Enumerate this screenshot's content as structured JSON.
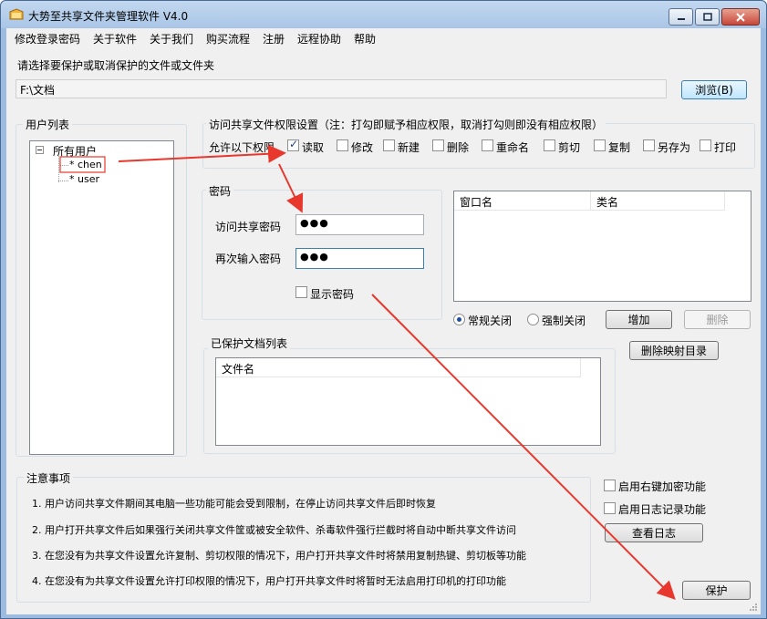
{
  "window": {
    "title": "大势至共享文件夹管理软件 V4.0",
    "controls": {
      "minimize": "minimize",
      "maximize": "maximize",
      "close": "close"
    }
  },
  "menu": [
    "修改登录密码",
    "关于软件",
    "关于我们",
    "购买流程",
    "注册",
    "远程协助",
    "帮助"
  ],
  "path_section": {
    "prompt": "请选择要保护或取消保护的文件或文件夹",
    "path_value": "F:\\文档",
    "browse_label": "浏览(B)"
  },
  "users": {
    "group_title": "用户列表",
    "root": "所有用户",
    "items": [
      "* chen",
      "* user"
    ],
    "selected_index": 0
  },
  "permissions": {
    "group_title": "访问共享文件权限设置（注：打勾即赋予相应权限，取消打勾则即没有相应权限）",
    "allow_label": "允许以下权限",
    "items": [
      {
        "label": "读取",
        "checked": true
      },
      {
        "label": "修改",
        "checked": false
      },
      {
        "label": "新建",
        "checked": false
      },
      {
        "label": "删除",
        "checked": false
      },
      {
        "label": "重命名",
        "checked": false
      },
      {
        "label": "剪切",
        "checked": false
      },
      {
        "label": "复制",
        "checked": false
      },
      {
        "label": "另存为",
        "checked": false
      },
      {
        "label": "打印",
        "checked": false
      }
    ]
  },
  "password": {
    "group_title": "密码",
    "access_label": "访问共享密码",
    "access_value": "●●●",
    "confirm_label": "再次输入密码",
    "confirm_value": "●●●",
    "show_label": "显示密码",
    "show_checked": false
  },
  "window_list": {
    "columns": [
      "窗口名",
      "类名"
    ],
    "close_modes": [
      {
        "label": "常规关闭",
        "checked": true
      },
      {
        "label": "强制关闭",
        "checked": false
      }
    ],
    "add_label": "增加",
    "delete_label": "删除"
  },
  "protected": {
    "group_title": "已保护文档列表",
    "column": "文件名",
    "delete_mapping_label": "删除映射目录"
  },
  "notes": {
    "group_title": "注意事项",
    "items": [
      "1. 用户访问共享文件期间其电脑一些功能可能会受到限制，在停止访问共享文件后即时恢复",
      "2. 用户打开共享文件后如果强行关闭共享文件筐或被安全软件、杀毒软件强行拦截时将自动中断共享文件访问",
      "3. 在您没有为共享文件设置允许复制、剪切权限的情况下，用户打开共享文件时将禁用复制热键、剪切板等功能",
      "4. 在您没有为共享文件设置允许打印权限的情况下，用户打开共享文件时将暂时无法启用打印机的打印功能"
    ]
  },
  "options": {
    "right_click_label": "启用右键加密功能",
    "right_click_checked": false,
    "log_label": "启用日志记录功能",
    "log_checked": false,
    "view_log_label": "查看日志",
    "protect_label": "保护"
  },
  "colors": {
    "titlebar": "#a9c5e6",
    "client": "#f0f0f0",
    "annotation": "#e8372c"
  }
}
